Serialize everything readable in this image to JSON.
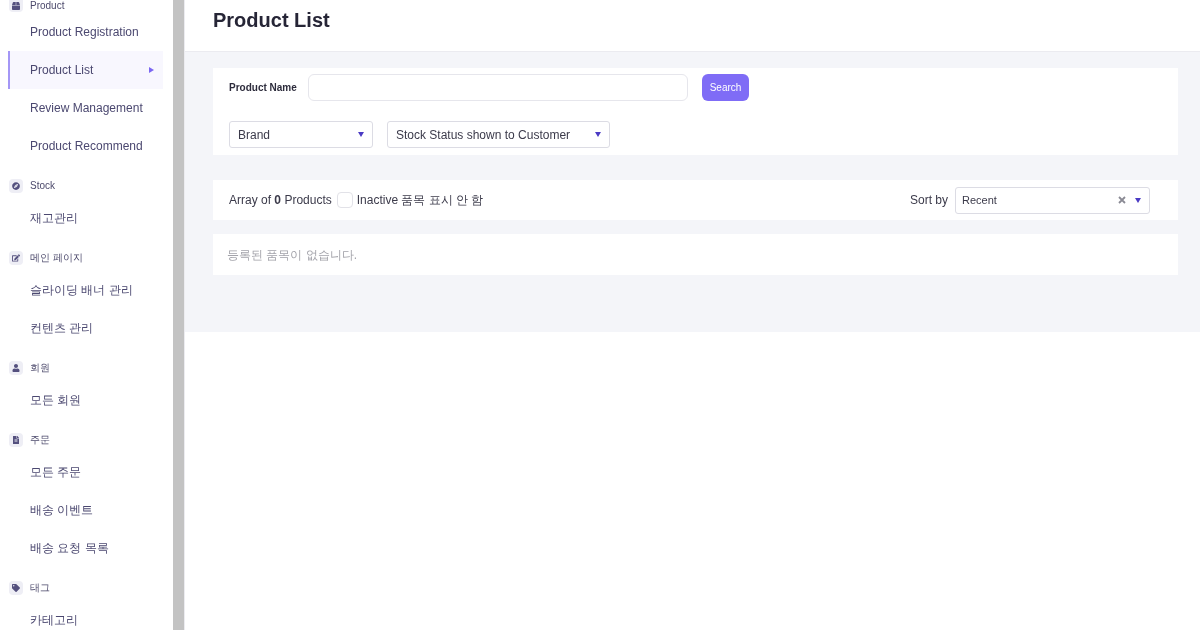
{
  "sidebar": {
    "sections": [
      {
        "title": "Product",
        "items": [
          {
            "label": "Product Registration",
            "selected": false
          },
          {
            "label": "Product List",
            "selected": true
          },
          {
            "label": "Review Management",
            "selected": false
          },
          {
            "label": "Product Recommend",
            "selected": false
          }
        ]
      },
      {
        "title": "Stock",
        "items": [
          {
            "label": "재고관리",
            "selected": false
          }
        ]
      },
      {
        "title": "메인 페이지",
        "items": [
          {
            "label": "슬라이딩 배너 관리",
            "selected": false
          },
          {
            "label": "컨텐츠 관리",
            "selected": false
          }
        ]
      },
      {
        "title": "회원",
        "items": [
          {
            "label": "모든 회원",
            "selected": false
          }
        ]
      },
      {
        "title": "주문",
        "items": [
          {
            "label": "모든 주문",
            "selected": false
          },
          {
            "label": "배송 이벤트",
            "selected": false
          },
          {
            "label": "배송 요청 목록",
            "selected": false
          }
        ]
      },
      {
        "title": "태그",
        "items": [
          {
            "label": "카테고리",
            "selected": false
          }
        ]
      }
    ]
  },
  "page_title": "Product List",
  "search_panel": {
    "product_name_label": "Product Name",
    "search_button": "Search",
    "dropdowns": [
      {
        "placeholder": "Brand"
      },
      {
        "placeholder": "Stock Status shown to Customer"
      }
    ]
  },
  "list_toolbar": {
    "count": "Array of **0** Products",
    "inactive_checkbox": {
      "label": "Inactive 품목 표시 안 함",
      "checked": false
    },
    "sort": {
      "label": "Sort by",
      "value": "Recent"
    }
  },
  "empty_message": "등록된 품목이 없습니다."
}
